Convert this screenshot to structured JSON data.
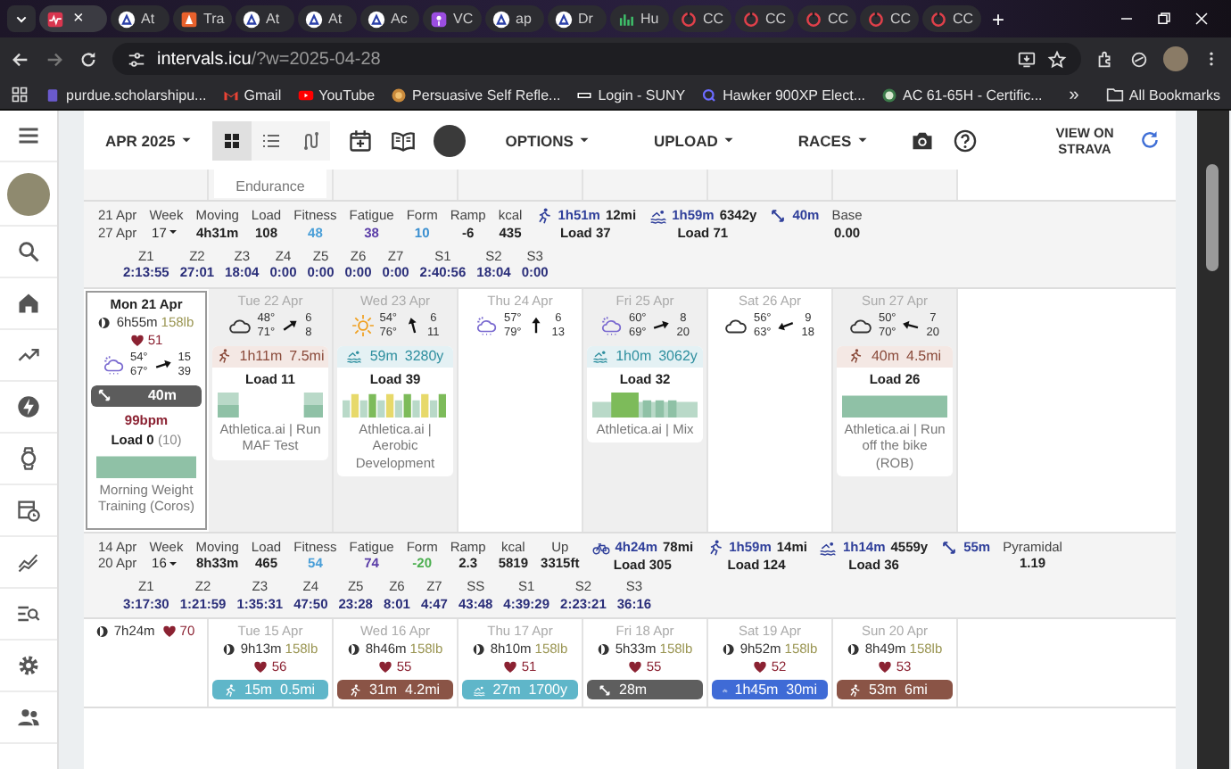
{
  "browser": {
    "tabs": [
      {
        "close": "×",
        "selected": true
      },
      {
        "label": "At",
        "selected": false
      },
      {
        "label": "Tra",
        "selected": false
      },
      {
        "label": "At",
        "selected": false
      },
      {
        "label": "At",
        "selected": false
      },
      {
        "label": "Ac",
        "selected": false
      },
      {
        "label": "VC",
        "selected": false
      },
      {
        "label": "ap",
        "selected": false
      },
      {
        "label": "Dr",
        "selected": false
      },
      {
        "label": "Hu",
        "selected": false
      },
      {
        "label": "CC",
        "selected": false
      },
      {
        "label": "CC",
        "selected": false
      },
      {
        "label": "CC",
        "selected": false
      },
      {
        "label": "CC",
        "selected": false
      },
      {
        "label": "CC",
        "selected": false
      }
    ],
    "new_tab": "+",
    "address": {
      "host": "intervals.icu",
      "path": "/?w=2025-04-28"
    },
    "bookmarks": [
      "purdue.scholarshipu...",
      "Gmail",
      "YouTube",
      "Persuasive Self Refle...",
      "Login - SUNY",
      "Hawker 900XP Elect...",
      "AC 61-65H - Certific..."
    ],
    "bookmarks_more": "»",
    "all_bookmarks": "All Bookmarks"
  },
  "toolbar": {
    "month": "APR 2025",
    "views": [
      {
        "kind": "grid",
        "selected": true
      },
      {
        "kind": "list",
        "selected": false
      },
      {
        "kind": "route",
        "selected": false
      }
    ],
    "menus": [
      "OPTIONS",
      "UPLOAD",
      "RACES"
    ],
    "strava": "VIEW ON STRAVA"
  },
  "previous_week_tail": {
    "title": "Endurance"
  },
  "weeks": [
    {
      "summary": {
        "dates": [
          "21 Apr",
          "27 Apr"
        ],
        "week": {
          "label": "Week",
          "value": "17"
        },
        "stats": [
          {
            "label": "Moving",
            "value": "4h31m"
          },
          {
            "label": "Load",
            "value": "108"
          },
          {
            "label": "Fitness",
            "value": "48",
            "color": "#4a9fd8"
          },
          {
            "label": "Fatigue",
            "value": "38",
            "color": "#5b3ea8"
          },
          {
            "label": "Form",
            "value": "10",
            "color": "#3a8fd0"
          },
          {
            "label": "Ramp",
            "value": "-6"
          },
          {
            "label": "kcal",
            "value": "435"
          }
        ],
        "sports": [
          {
            "kind": "run",
            "time": "1h51m",
            "distance": "12mi",
            "load": "Load 37"
          },
          {
            "kind": "swim",
            "time": "1h59m",
            "distance": "6342y",
            "load": "Load 71"
          },
          {
            "kind": "strength",
            "time": "40m"
          }
        ],
        "extra": {
          "label": "Base",
          "value": "0.00"
        },
        "zones": [
          {
            "label": "Z1",
            "value": "2:13:55"
          },
          {
            "label": "Z2",
            "value": "27:01"
          },
          {
            "label": "Z3",
            "value": "18:04"
          },
          {
            "label": "Z4",
            "value": "0:00"
          },
          {
            "label": "Z5",
            "value": "0:00"
          },
          {
            "label": "Z6",
            "value": "0:00"
          },
          {
            "label": "Z7",
            "value": "0:00"
          },
          {
            "label": "S1",
            "value": "2:40:56"
          },
          {
            "label": "S2",
            "value": "18:04"
          },
          {
            "label": "S3",
            "value": "0:00"
          }
        ]
      },
      "days": [
        {
          "label": "Mon 21 Apr",
          "today": true,
          "sleep": "6h55m",
          "weight": "158lb",
          "hr": "51",
          "weather": {
            "kind": "rain",
            "low": "54°",
            "high": "67°",
            "wind": "15",
            "gust": "39"
          },
          "activities": [
            {
              "kind": "strength",
              "duration": "40m",
              "hr": "99bpm",
              "load": "Load 0",
              "load_note": "(10)",
              "title": "Morning Weight Training (Coros)"
            }
          ]
        },
        {
          "label": "Tue 22 Apr",
          "today": false,
          "weather": {
            "kind": "cloud",
            "low": "48°",
            "high": "71°",
            "wind": "6",
            "gust": "8"
          },
          "activities": [
            {
              "kind": "run",
              "duration": "1h11m",
              "distance": "7.5mi",
              "load": "Load 11",
              "title": "Athletica.ai | Run MAF Test"
            }
          ]
        },
        {
          "label": "Wed 23 Apr",
          "today": false,
          "weather": {
            "kind": "sun",
            "low": "54°",
            "high": "76°",
            "wind": "6",
            "gust": "11"
          },
          "activities": [
            {
              "kind": "swim",
              "duration": "59m",
              "distance": "3280y",
              "load": "Load 39",
              "title": "Athletica.ai | Aerobic Development"
            }
          ]
        },
        {
          "label": "Thu 24 Apr",
          "today": false,
          "weather": {
            "kind": "rain",
            "low": "57°",
            "high": "79°",
            "wind": "6",
            "gust": "13"
          }
        },
        {
          "label": "Fri 25 Apr",
          "today": false,
          "weather": {
            "kind": "rain",
            "low": "60°",
            "high": "69°",
            "wind": "8",
            "gust": "20"
          },
          "activities": [
            {
              "kind": "swim",
              "duration": "1h0m",
              "distance": "3062y",
              "load": "Load 32",
              "title": "Athletica.ai | Mix"
            }
          ]
        },
        {
          "label": "Sat 26 Apr",
          "today": false,
          "weather": {
            "kind": "cloud",
            "low": "56°",
            "high": "63°",
            "wind": "9",
            "gust": "18"
          }
        },
        {
          "label": "Sun 27 Apr",
          "today": false,
          "weather": {
            "kind": "cloud",
            "low": "50°",
            "high": "70°",
            "wind": "7",
            "gust": "20"
          },
          "activities": [
            {
              "kind": "run",
              "duration": "40m",
              "distance": "4.5mi",
              "load": "Load 26",
              "title": "Athletica.ai | Run off the bike (ROB)"
            }
          ]
        }
      ]
    },
    {
      "summary": {
        "dates": [
          "14 Apr",
          "20 Apr"
        ],
        "week": {
          "label": "Week",
          "value": "16"
        },
        "stats": [
          {
            "label": "Moving",
            "value": "8h33m"
          },
          {
            "label": "Load",
            "value": "465"
          },
          {
            "label": "Fitness",
            "value": "54",
            "color": "#4a9fd8"
          },
          {
            "label": "Fatigue",
            "value": "74",
            "color": "#5b3ea8"
          },
          {
            "label": "Form",
            "value": "-20",
            "color": "#4caf50"
          },
          {
            "label": "Ramp",
            "value": "2.3"
          },
          {
            "label": "kcal",
            "value": "5819"
          },
          {
            "label": "Up",
            "value": "3315ft"
          }
        ],
        "sports": [
          {
            "kind": "bike",
            "time": "4h24m",
            "distance": "78mi",
            "load": "Load 305"
          },
          {
            "kind": "run",
            "time": "1h59m",
            "distance": "14mi",
            "load": "Load 124"
          },
          {
            "kind": "swim",
            "time": "1h14m",
            "distance": "4559y",
            "load": "Load 36"
          },
          {
            "kind": "strength",
            "time": "55m"
          }
        ],
        "extra": {
          "label": "Pyramidal",
          "value": "1.19"
        },
        "zones": [
          {
            "label": "Z1",
            "value": "3:17:30"
          },
          {
            "label": "Z2",
            "value": "1:21:59"
          },
          {
            "label": "Z3",
            "value": "1:35:31"
          },
          {
            "label": "Z4",
            "value": "47:50"
          },
          {
            "label": "Z5",
            "value": "23:28"
          },
          {
            "label": "Z6",
            "value": "8:01"
          },
          {
            "label": "Z7",
            "value": "4:47"
          },
          {
            "label": "SS",
            "value": "43:48"
          },
          {
            "label": "S1",
            "value": "4:39:29"
          },
          {
            "label": "S2",
            "value": "2:23:21"
          },
          {
            "label": "S3",
            "value": "36:16"
          }
        ]
      },
      "days": [
        {
          "sleep": "7h24m",
          "hr": "70",
          "today": false
        },
        {
          "label": "Tue 15 Apr",
          "today": false,
          "sleep": "9h13m",
          "weight": "158lb",
          "hr": "56",
          "chips": [
            {
              "kind": "run",
              "text": "15m  0.5mi",
              "color": "#5fb6c9"
            }
          ]
        },
        {
          "label": "Wed 16 Apr",
          "today": false,
          "sleep": "8h46m",
          "weight": "158lb",
          "hr": "55",
          "chips": [
            {
              "kind": "run",
              "text": "31m  4.2mi",
              "color": "#8a5446"
            }
          ]
        },
        {
          "label": "Thu 17 Apr",
          "today": false,
          "sleep": "8h10m",
          "weight": "158lb",
          "hr": "51",
          "chips": [
            {
              "kind": "swim",
              "text": "27m  1700y",
              "color": "#5fb6c9"
            }
          ]
        },
        {
          "label": "Fri 18 Apr",
          "today": false,
          "sleep": "5h33m",
          "weight": "158lb",
          "hr": "55",
          "chips": [
            {
              "kind": "strength",
              "text": "28m",
              "color": "#5e5e5e"
            }
          ]
        },
        {
          "label": "Sat 19 Apr",
          "today": false,
          "sleep": "9h52m",
          "weight": "158lb",
          "hr": "52",
          "chips": [
            {
              "kind": "bike",
              "text": "1h45m  30mi",
              "color": "#3f6bd6"
            }
          ]
        },
        {
          "label": "Sun 20 Apr",
          "today": false,
          "sleep": "8h49m",
          "weight": "158lb",
          "hr": "53",
          "chips": [
            {
              "kind": "run",
              "text": "53m  6mi",
              "color": "#8a5446"
            }
          ]
        }
      ]
    }
  ]
}
